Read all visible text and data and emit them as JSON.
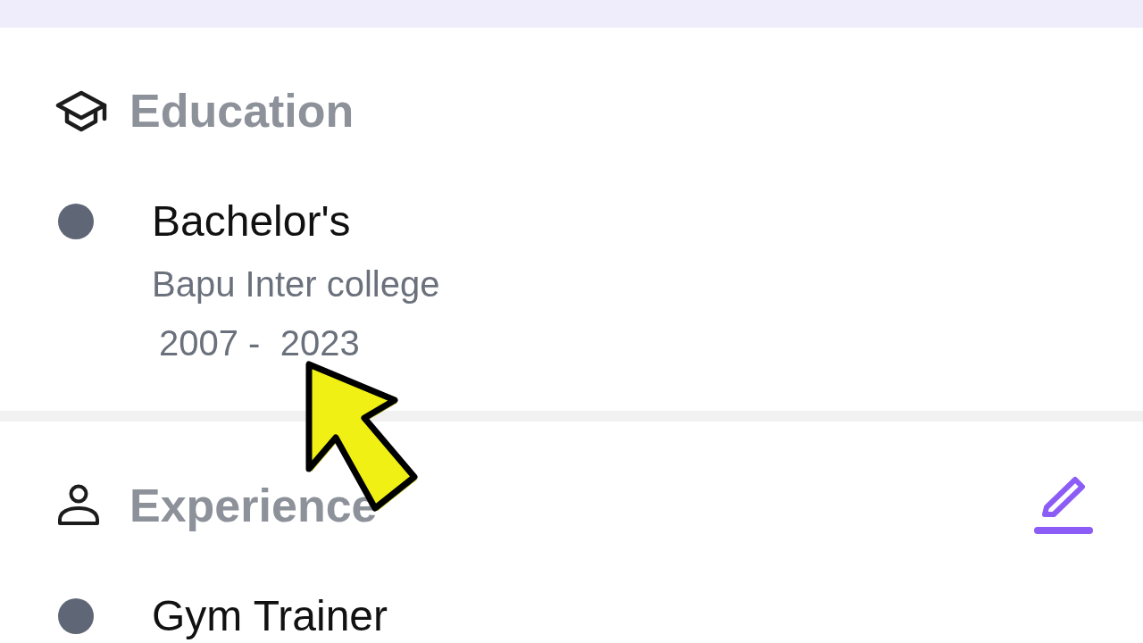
{
  "sections": [
    {
      "kind": "education",
      "title": "Education",
      "entries": [
        {
          "title": "Bachelor's",
          "details": [
            "Bapu Inter college",
            "2007 -  2023"
          ]
        }
      ]
    },
    {
      "kind": "experience",
      "title": "Experience",
      "editable": true,
      "entries": [
        {
          "title": "Gym Trainer"
        }
      ]
    }
  ]
}
